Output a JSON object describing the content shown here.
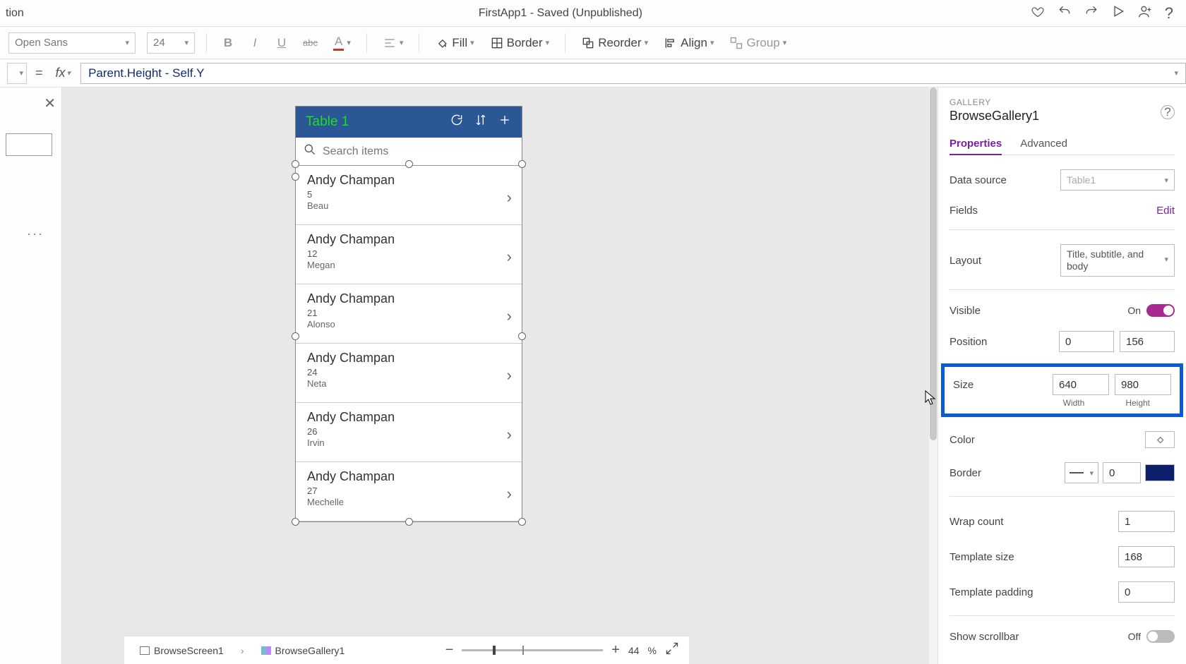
{
  "titlebar": {
    "left": "tion",
    "title": "FirstApp1 - Saved (Unpublished)"
  },
  "ribbon": {
    "font": "Open Sans",
    "size": "24",
    "fill": "Fill",
    "border": "Border",
    "reorder": "Reorder",
    "align": "Align",
    "group": "Group"
  },
  "formula": {
    "text": "Parent.Height - Self.Y"
  },
  "phone": {
    "title": "Table 1",
    "search_placeholder": "Search items",
    "items": [
      {
        "title": "Andy Champan",
        "sub": "5",
        "body": "Beau"
      },
      {
        "title": "Andy Champan",
        "sub": "12",
        "body": "Megan"
      },
      {
        "title": "Andy Champan",
        "sub": "21",
        "body": "Alonso"
      },
      {
        "title": "Andy Champan",
        "sub": "24",
        "body": "Neta"
      },
      {
        "title": "Andy Champan",
        "sub": "26",
        "body": "Irvin"
      },
      {
        "title": "Andy Champan",
        "sub": "27",
        "body": "Mechelle"
      }
    ]
  },
  "right": {
    "kind": "GALLERY",
    "name": "BrowseGallery1",
    "tabs": {
      "properties": "Properties",
      "advanced": "Advanced"
    },
    "data_source_label": "Data source",
    "data_source_value": "Table1",
    "fields_label": "Fields",
    "fields_edit": "Edit",
    "layout_label": "Layout",
    "layout_value": "Title, subtitle, and body",
    "visible_label": "Visible",
    "visible_value": "On",
    "position_label": "Position",
    "position_x": "0",
    "position_y": "156",
    "size_label": "Size",
    "size_w": "640",
    "size_h": "980",
    "size_w_label": "Width",
    "size_h_label": "Height",
    "color_label": "Color",
    "border_label": "Border",
    "border_value": "0",
    "wrap_label": "Wrap count",
    "wrap_value": "1",
    "tpl_size_label": "Template size",
    "tpl_size_value": "168",
    "tpl_pad_label": "Template padding",
    "tpl_pad_value": "0",
    "scroll_label": "Show scrollbar",
    "scroll_value": "Off"
  },
  "status": {
    "crumb1": "BrowseScreen1",
    "crumb2": "BrowseGallery1",
    "zoom": "44",
    "pct": "%"
  }
}
